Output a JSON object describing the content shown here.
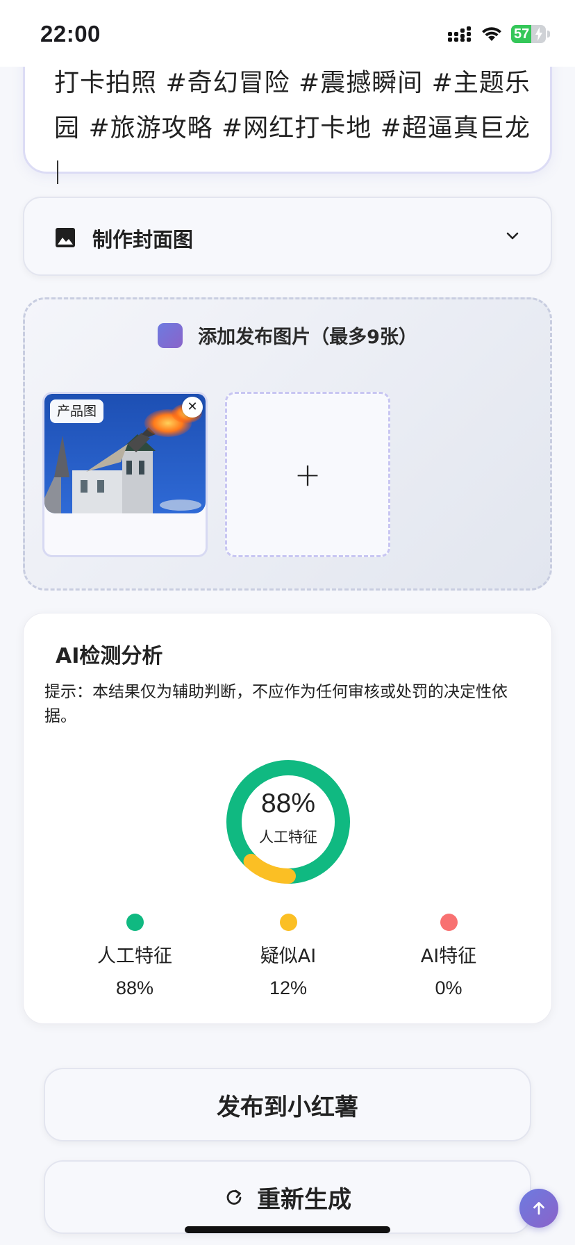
{
  "status_bar": {
    "time": "22:00",
    "battery": "57",
    "battery_level_percent": 57,
    "icons": [
      "signal-icon",
      "wifi-icon",
      "battery-icon"
    ]
  },
  "caption": {
    "text": "打卡拍照 #奇幻冒险 #震撼瞬间 #主题乐园 #旅游攻略 #网红打卡地 #超逼真巨龙"
  },
  "cover": {
    "label": "制作封面图",
    "icon": "image-icon",
    "toggle_icon": "chevron-down-icon"
  },
  "upload": {
    "title": "添加发布图片（最多9张）",
    "images": [
      {
        "tag": "产品图",
        "close_symbol": "✕"
      }
    ],
    "add_symbol": "+"
  },
  "ai_analysis": {
    "title": "AI检测分析",
    "note": "提示：本结果仅为辅助判断，不应作为任何审核或处罚的决定性依据。",
    "center_value": "88%",
    "center_label": "人工特征",
    "legend": [
      {
        "name": "人工特征",
        "value": "88%",
        "color": "#10b981"
      },
      {
        "name": "疑似AI",
        "value": "12%",
        "color": "#fbbf24"
      },
      {
        "name": "AI特征",
        "value": "0%",
        "color": "#f87171"
      }
    ]
  },
  "chart_data": {
    "type": "pie",
    "categories": [
      "人工特征",
      "疑似AI",
      "AI特征"
    ],
    "values": [
      88,
      12,
      0
    ],
    "colors": [
      "#10b981",
      "#fbbf24",
      "#f87171"
    ],
    "title": "",
    "donut": true
  },
  "actions": {
    "publish_label": "发布到小红薯",
    "regenerate_label": "重新生成"
  },
  "colors": {
    "accent": "#7b6fd6",
    "human": "#10b981",
    "suspect": "#fbbf24",
    "ai": "#f87171"
  }
}
